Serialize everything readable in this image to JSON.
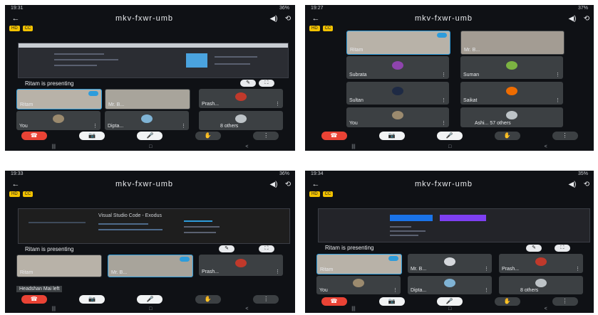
{
  "shots": [
    {
      "status": {
        "time": "19:31",
        "battery": "36%"
      },
      "title": "mkv-fxwr-umb",
      "badges": [
        "HD",
        "CC"
      ],
      "presenting_text": "Ritam is presenting",
      "tiles": [
        {
          "name": "Ritam",
          "type": "video"
        },
        {
          "name": "Mr. B...",
          "type": "video"
        },
        {
          "name": "Prash...",
          "type": "avatar",
          "avatar_color": "#c0392b"
        },
        {
          "name": "You",
          "type": "avatar",
          "avatar_color": "#9b8a6e"
        },
        {
          "name": "Dipta...",
          "type": "avatar",
          "avatar_color": "#7fb3d5"
        },
        {
          "name": "8 others",
          "type": "others",
          "avatar_color": "#bdc3c7"
        }
      ],
      "controls": {
        "end": "☎",
        "mic": "🎤",
        "video": "📷",
        "raise": "✋",
        "more": "⋮"
      },
      "nav": {
        "left": "|||",
        "home": "□",
        "back": "<"
      }
    },
    {
      "status": {
        "time": "19:27",
        "battery": "37%"
      },
      "title": "mkv-fxwr-umb",
      "badges": [
        "HD",
        "CC"
      ],
      "tiles": [
        {
          "name": "Ritam",
          "type": "video"
        },
        {
          "name": "Mr. B...",
          "type": "video"
        },
        {
          "name": "Subrata",
          "type": "avatar",
          "avatar_color": "#8e44ad"
        },
        {
          "name": "Suman",
          "type": "avatar",
          "avatar_color": "#7cb342"
        },
        {
          "name": "Sultan",
          "type": "avatar",
          "avatar_color": "#1e2a44"
        },
        {
          "name": "Saikat",
          "type": "avatar",
          "avatar_color": "#ef6c00"
        },
        {
          "name": "You",
          "type": "avatar",
          "avatar_color": "#9b8a6e"
        },
        {
          "name": "Ashi... 57 others",
          "type": "others",
          "avatar_color": "#bdc3c7"
        }
      ],
      "controls": {
        "end": "☎",
        "mic": "🎤",
        "video": "📷",
        "raise": "✋",
        "more": "⋮"
      },
      "nav": {
        "left": "|||",
        "home": "□",
        "back": "<"
      }
    },
    {
      "status": {
        "time": "19:33",
        "battery": "36%"
      },
      "title": "mkv-fxwr-umb",
      "badges": [
        "HD",
        "CC"
      ],
      "screen_title": "Visual Studio Code - Exodus",
      "presenting_text": "Ritam is presenting",
      "tiles": [
        {
          "name": "Ritam",
          "type": "video"
        },
        {
          "name": "Mr. B...",
          "type": "video"
        },
        {
          "name": "Prash...",
          "type": "avatar",
          "avatar_color": "#c0392b"
        }
      ],
      "toast": "Headshan Mai left",
      "controls": {
        "end": "☎",
        "mic": "🎤",
        "video": "📷",
        "raise": "✋",
        "more": "⋮"
      },
      "nav": {
        "left": "|||",
        "home": "□",
        "back": "<"
      }
    },
    {
      "status": {
        "time": "19:34",
        "battery": "35%"
      },
      "title": "mkv-fxwr-umb",
      "badges": [
        "HD",
        "CC"
      ],
      "presenting_text": "Ritam is presenting",
      "tiles": [
        {
          "name": "Ritam",
          "type": "video"
        },
        {
          "name": "Mr. B...",
          "type": "avatar",
          "avatar_color": "#d5d8dc"
        },
        {
          "name": "Prash...",
          "type": "avatar",
          "avatar_color": "#c0392b"
        },
        {
          "name": "You",
          "type": "avatar",
          "avatar_color": "#9b8a6e"
        },
        {
          "name": "Dipta...",
          "type": "avatar",
          "avatar_color": "#7fb3d5"
        },
        {
          "name": "8 others",
          "type": "others",
          "avatar_color": "#bdc3c7"
        }
      ],
      "controls": {
        "end": "☎",
        "mic": "🎤",
        "video": "📷",
        "raise": "✋",
        "more": "⋮"
      },
      "nav": {
        "left": "|||",
        "home": "□",
        "back": "<"
      }
    }
  ],
  "colors": {
    "accent_blue": "#2d9cdb",
    "end_call_red": "#ea4335",
    "badge_yellow": "#f2c200",
    "screen_blue": "#1a73e8",
    "screen_purple": "#7e3ff2"
  }
}
